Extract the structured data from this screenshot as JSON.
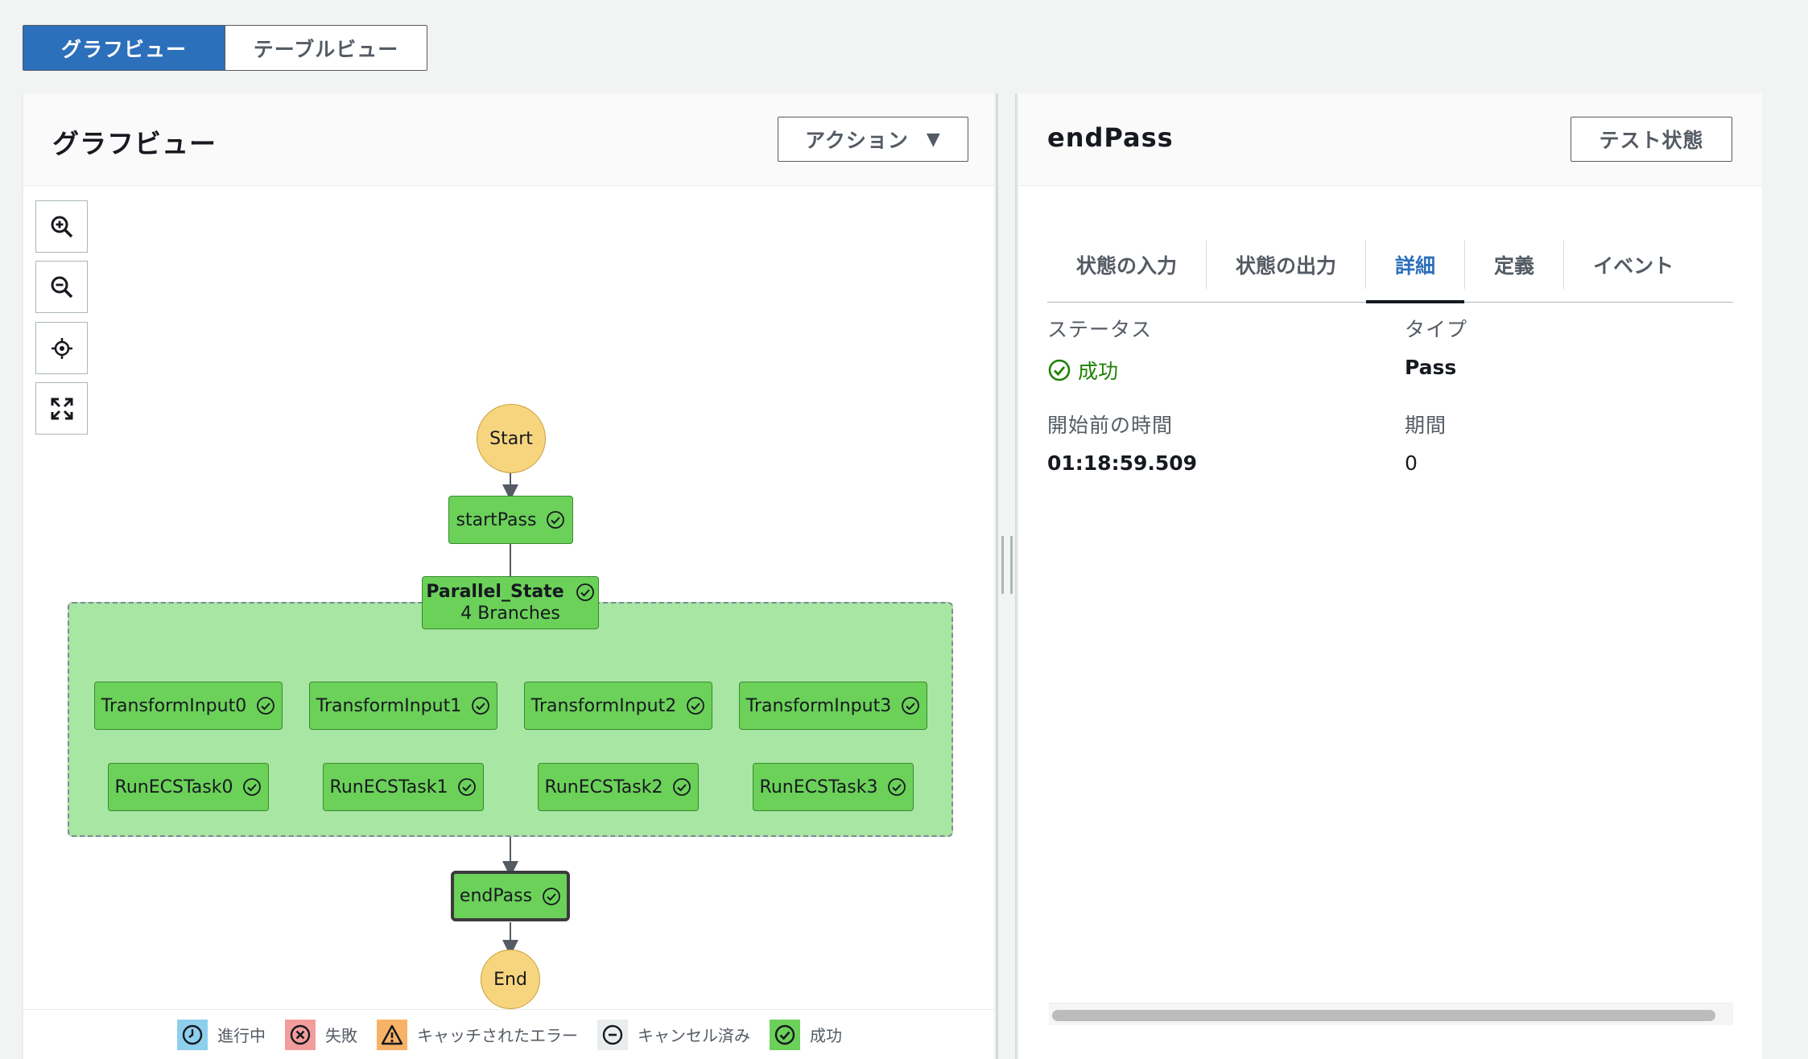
{
  "view_toggle": {
    "graph": "グラフビュー",
    "table": "テーブルビュー"
  },
  "left_panel": {
    "title": "グラフビュー",
    "action_label": "アクション",
    "action_caret": "▼"
  },
  "tools": [
    "zoom-in-icon",
    "zoom-out-icon",
    "center-icon",
    "fit-icon"
  ],
  "graph": {
    "start": "Start",
    "end": "End",
    "start_pass": "startPass",
    "parallel": {
      "name": "Parallel_State",
      "branches": "4 Branches"
    },
    "branches": [
      {
        "transform": "TransformInput0",
        "task": "RunECSTask0"
      },
      {
        "transform": "TransformInput1",
        "task": "RunECSTask1"
      },
      {
        "transform": "TransformInput2",
        "task": "RunECSTask2"
      },
      {
        "transform": "TransformInput3",
        "task": "RunECSTask3"
      }
    ],
    "end_pass": "endPass"
  },
  "legend": {
    "in_progress": "進行中",
    "failed": "失敗",
    "caught_error": "キャッチされたエラー",
    "cancelled": "キャンセル済み",
    "succeeded": "成功",
    "colors": {
      "in_progress": "#8ecfed",
      "failed": "#f29d9d",
      "caught_error": "#f7b267",
      "cancelled": "#eaeded",
      "succeeded": "#6bd159"
    }
  },
  "right_panel": {
    "title": "endPass",
    "test_label": "テスト状態",
    "tabs": [
      "状態の入力",
      "状態の出力",
      "詳細",
      "定義",
      "イベント"
    ],
    "active_tab": "詳細",
    "status_label": "ステータス",
    "status_value": "成功",
    "type_label": "タイプ",
    "type_value": "Pass",
    "start_time_label": "開始前の時間",
    "start_time_value": "01:18:59.509",
    "duration_label": "期間",
    "duration_value": "0"
  }
}
